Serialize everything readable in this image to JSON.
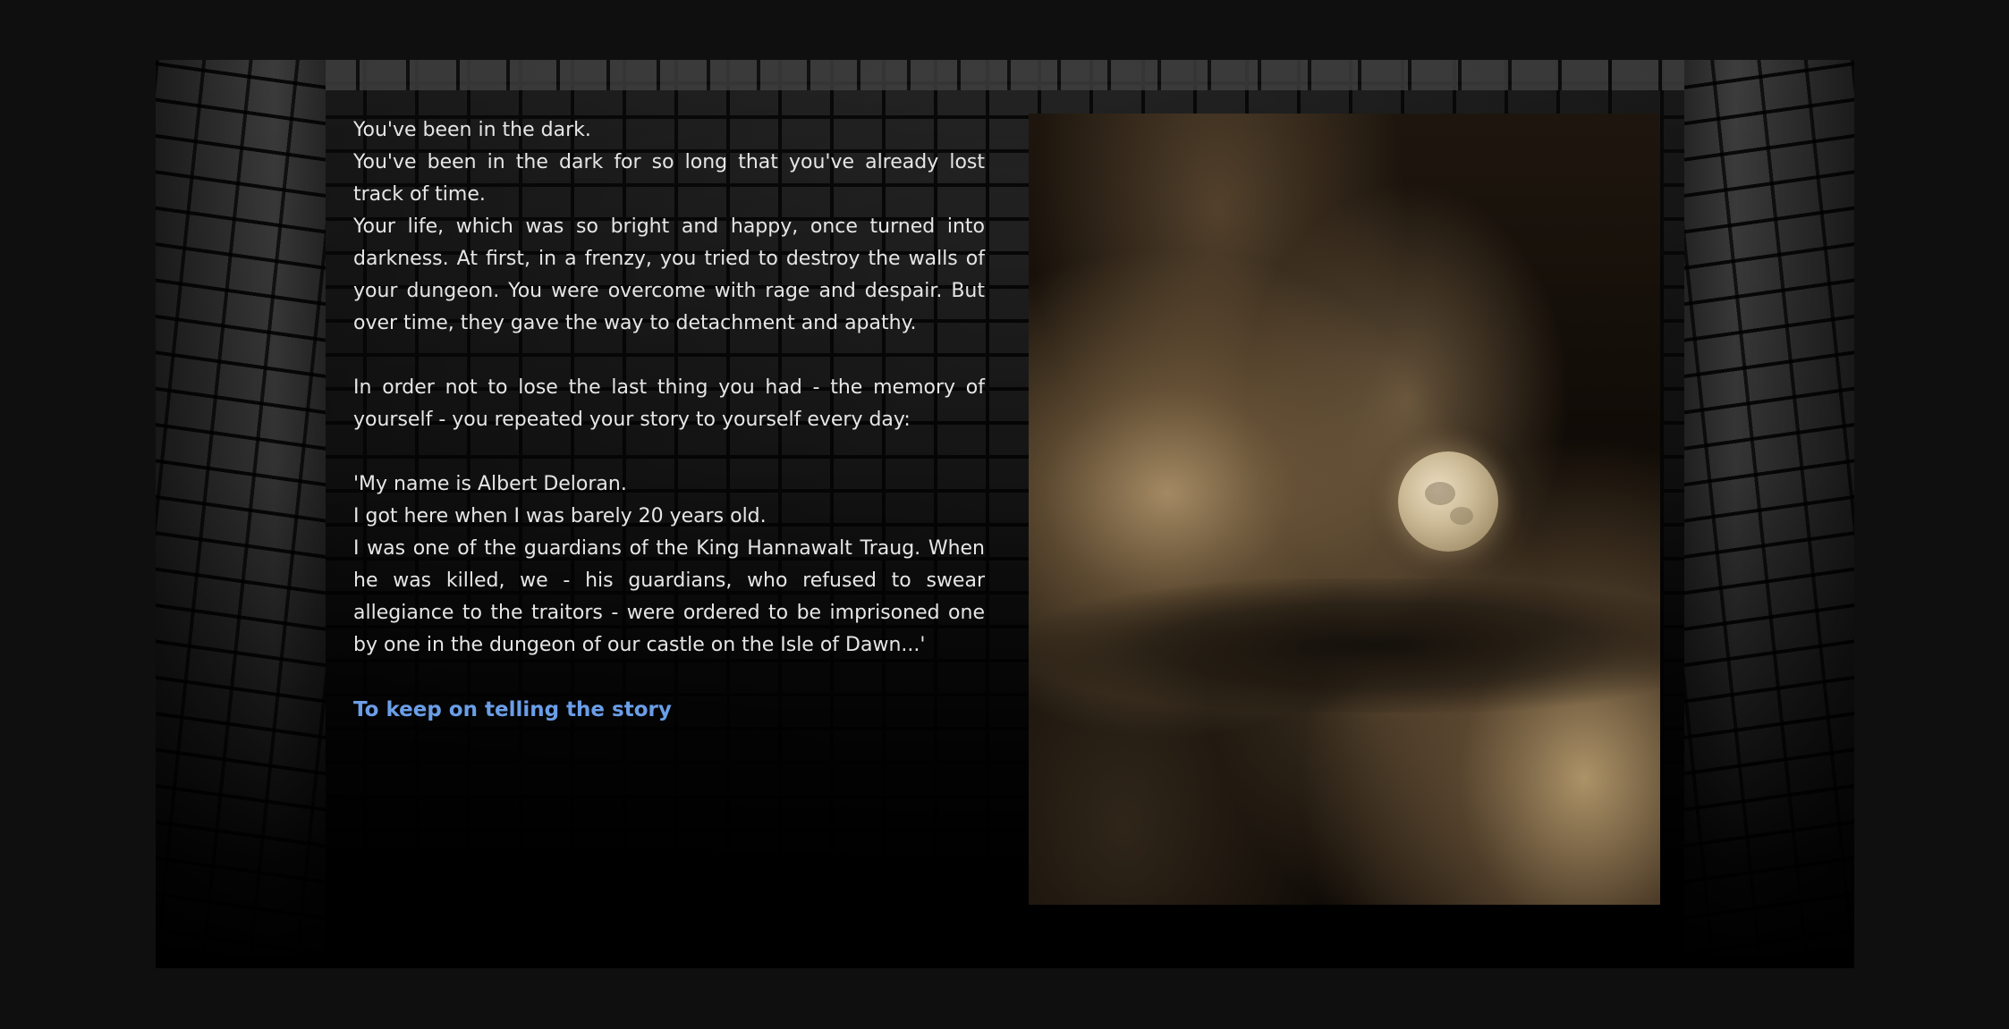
{
  "story": {
    "paragraph_1": "You've been in the dark.",
    "paragraph_2": "You've been in the dark for so long that you've already lost track of time.",
    "paragraph_3": "Your life, which was so bright and happy, once turned into darkness. At first, in a frenzy, you tried to destroy the walls of your dungeon. You were overcome with rage and despair. But over time, they gave the way to detachment and apathy.",
    "paragraph_4": "In order not to lose the last thing you had - the memory of yourself - you repeated your story to yourself every day:",
    "paragraph_5": "'My name is Albert Deloran.",
    "paragraph_6": "I got here when I was barely 20 years old.",
    "paragraph_7": "I was one of the guardians of the King Hannawalt Traug. When he was killed, we - his guardians, who refused to swear allegiance to the traitors - were ordered to be imprisoned one by one in the dungeon of our castle on the Isle of Dawn...'",
    "continue_link": "To keep on telling the story"
  },
  "colors": {
    "text": "#e6e6e6",
    "link": "#6b9ee8",
    "page_background": "#0f0f0f"
  },
  "illustration": {
    "subject": "full moon behind clouds"
  }
}
